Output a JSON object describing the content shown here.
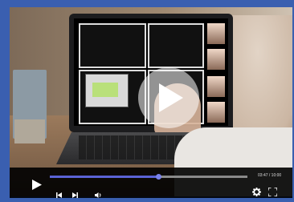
{
  "player": {
    "time_display": "03:47 / 10:00",
    "progress": 0.55
  },
  "icons": {
    "overlay": "play-icon",
    "play": "play-icon",
    "prev": "skip-back-icon",
    "next": "skip-forward-icon",
    "volume": "volume-icon",
    "settings": "gear-icon",
    "fullscreen": "fullscreen-icon"
  },
  "colors": {
    "frame": "#3a5fb0",
    "progress_fill": "#5b63d6",
    "controls_bg": "#000000"
  }
}
